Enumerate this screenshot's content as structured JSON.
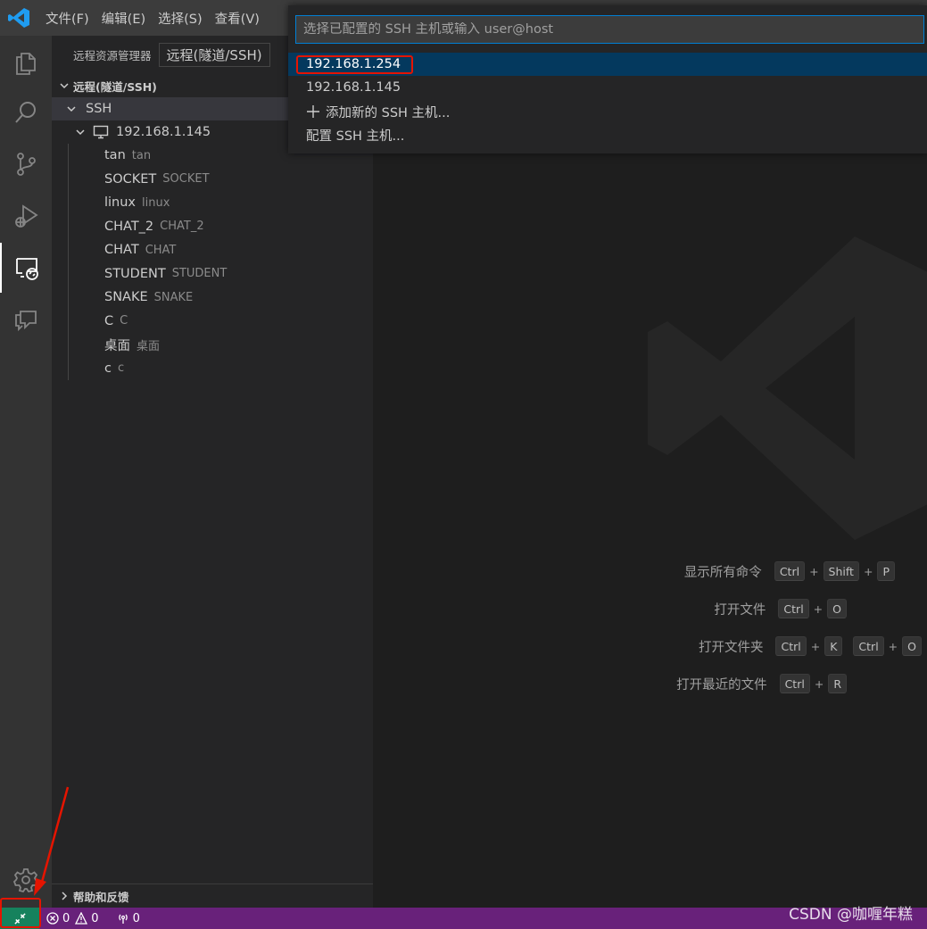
{
  "menu": [
    "文件(F)",
    "编辑(E)",
    "选择(S)",
    "查看(V)"
  ],
  "sidebar": {
    "title": "远程资源管理器",
    "dropdown_tooltip": "远程(隧道/SSH)",
    "section": "远程(隧道/SSH)",
    "group": "SSH",
    "host": "192.168.1.145",
    "folders": [
      {
        "name": "tan",
        "desc": "tan"
      },
      {
        "name": "SOCKET",
        "desc": "SOCKET"
      },
      {
        "name": "linux",
        "desc": "linux"
      },
      {
        "name": "CHAT_2",
        "desc": "CHAT_2"
      },
      {
        "name": "CHAT",
        "desc": "CHAT"
      },
      {
        "name": "STUDENT",
        "desc": "STUDENT"
      },
      {
        "name": "SNAKE",
        "desc": "SNAKE"
      },
      {
        "name": "C",
        "desc": "C"
      },
      {
        "name": "桌面",
        "desc": "桌面"
      },
      {
        "name": "c",
        "desc": "c"
      }
    ],
    "bottom_section": "帮助和反馈"
  },
  "quickpick": {
    "placeholder": "选择已配置的 SSH 主机或输入 user@host",
    "items": [
      "192.168.1.254",
      "192.168.1.145",
      "添加新的 SSH 主机...",
      "配置 SSH 主机..."
    ]
  },
  "shortcuts": [
    {
      "label": "显示所有命令",
      "keys": [
        [
          "Ctrl",
          "Shift",
          "P"
        ]
      ]
    },
    {
      "label": "打开文件",
      "keys": [
        [
          "Ctrl",
          "O"
        ]
      ]
    },
    {
      "label": "打开文件夹",
      "keys": [
        [
          "Ctrl",
          "K"
        ],
        [
          "Ctrl",
          "O"
        ]
      ]
    },
    {
      "label": "打开最近的文件",
      "keys": [
        [
          "Ctrl",
          "R"
        ]
      ]
    }
  ],
  "statusbar": {
    "errors": "0",
    "warnings": "0",
    "ports": "0"
  },
  "watermark": "CSDN @咖喱年糕",
  "colors": {
    "accent": "#007fd4",
    "statusbar": "#68217a",
    "remote": "#16825d",
    "highlight": "#e51400"
  }
}
